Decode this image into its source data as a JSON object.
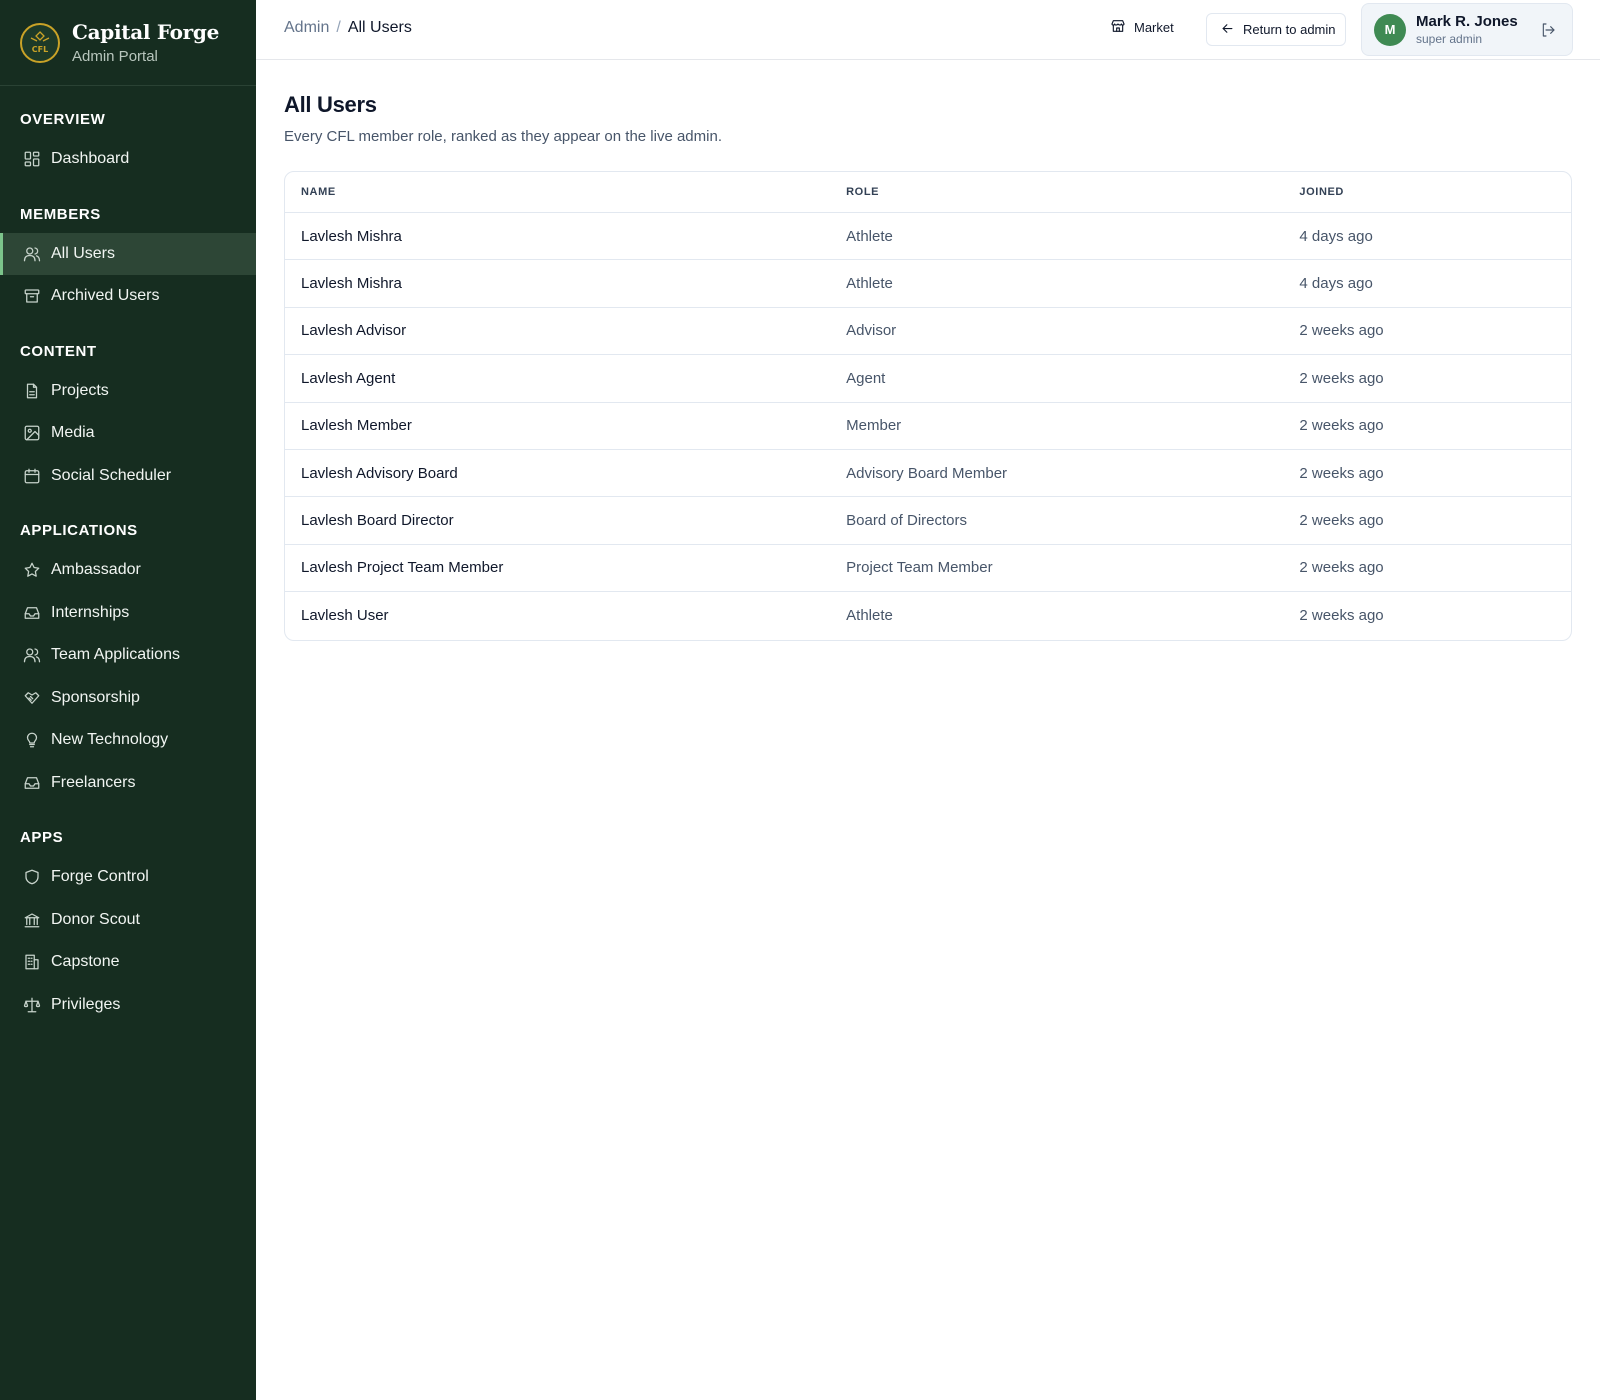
{
  "brand": {
    "title": "Capital Forge",
    "subtitle": "Admin Portal",
    "logo_text": "CFL"
  },
  "sidebar": {
    "sections": [
      {
        "heading": "OVERVIEW",
        "items": [
          {
            "label": "Dashboard",
            "icon": "dashboard-icon"
          }
        ]
      },
      {
        "heading": "MEMBERS",
        "items": [
          {
            "label": "All Users",
            "icon": "users-icon",
            "active": true
          },
          {
            "label": "Archived Users",
            "icon": "archive-icon"
          }
        ]
      },
      {
        "heading": "CONTENT",
        "items": [
          {
            "label": "Projects",
            "icon": "file-icon"
          },
          {
            "label": "Media",
            "icon": "image-icon"
          },
          {
            "label": "Social Scheduler",
            "icon": "calendar-icon"
          }
        ]
      },
      {
        "heading": "APPLICATIONS",
        "items": [
          {
            "label": "Ambassador",
            "icon": "star-icon"
          },
          {
            "label": "Internships",
            "icon": "inbox-icon"
          },
          {
            "label": "Team Applications",
            "icon": "users-icon"
          },
          {
            "label": "Sponsorship",
            "icon": "handshake-icon"
          },
          {
            "label": "New Technology",
            "icon": "lightbulb-icon"
          },
          {
            "label": "Freelancers",
            "icon": "inbox-icon"
          }
        ]
      },
      {
        "heading": "APPS",
        "items": [
          {
            "label": "Forge Control",
            "icon": "shield-icon"
          },
          {
            "label": "Donor Scout",
            "icon": "bank-icon"
          },
          {
            "label": "Capstone",
            "icon": "building-icon"
          },
          {
            "label": "Privileges",
            "icon": "scale-icon"
          }
        ]
      }
    ]
  },
  "header": {
    "breadcrumb": {
      "root": "Admin",
      "separator": "/",
      "current": "All Users"
    },
    "market_label": "Market",
    "return_label": "Return to admin",
    "user": {
      "initial": "M",
      "name": "Mark R. Jones",
      "role": "super admin"
    }
  },
  "main": {
    "title": "All Users",
    "subtitle": "Every CFL member role, ranked as they appear on the live admin.",
    "table": {
      "columns": [
        "NAME",
        "ROLE",
        "JOINED"
      ],
      "rows": [
        {
          "name": "Lavlesh Mishra",
          "role": "Athlete",
          "joined": "4 days ago"
        },
        {
          "name": "Lavlesh Mishra",
          "role": "Athlete",
          "joined": "4 days ago"
        },
        {
          "name": "Lavlesh Advisor",
          "role": "Advisor",
          "joined": "2 weeks ago"
        },
        {
          "name": "Lavlesh Agent",
          "role": "Agent",
          "joined": "2 weeks ago"
        },
        {
          "name": "Lavlesh Member",
          "role": "Member",
          "joined": "2 weeks ago"
        },
        {
          "name": "Lavlesh Advisory Board",
          "role": "Advisory Board Member",
          "joined": "2 weeks ago"
        },
        {
          "name": "Lavlesh Board Director",
          "role": "Board of Directors",
          "joined": "2 weeks ago"
        },
        {
          "name": "Lavlesh Project Team Member",
          "role": "Project Team Member",
          "joined": "2 weeks ago"
        },
        {
          "name": "Lavlesh User",
          "role": "Athlete",
          "joined": "2 weeks ago"
        }
      ]
    }
  },
  "colors": {
    "sidebar_bg": "#162d20",
    "accent": "#7cc48b",
    "avatar_bg": "#3f8a53",
    "logo_gold": "#c9a227"
  }
}
